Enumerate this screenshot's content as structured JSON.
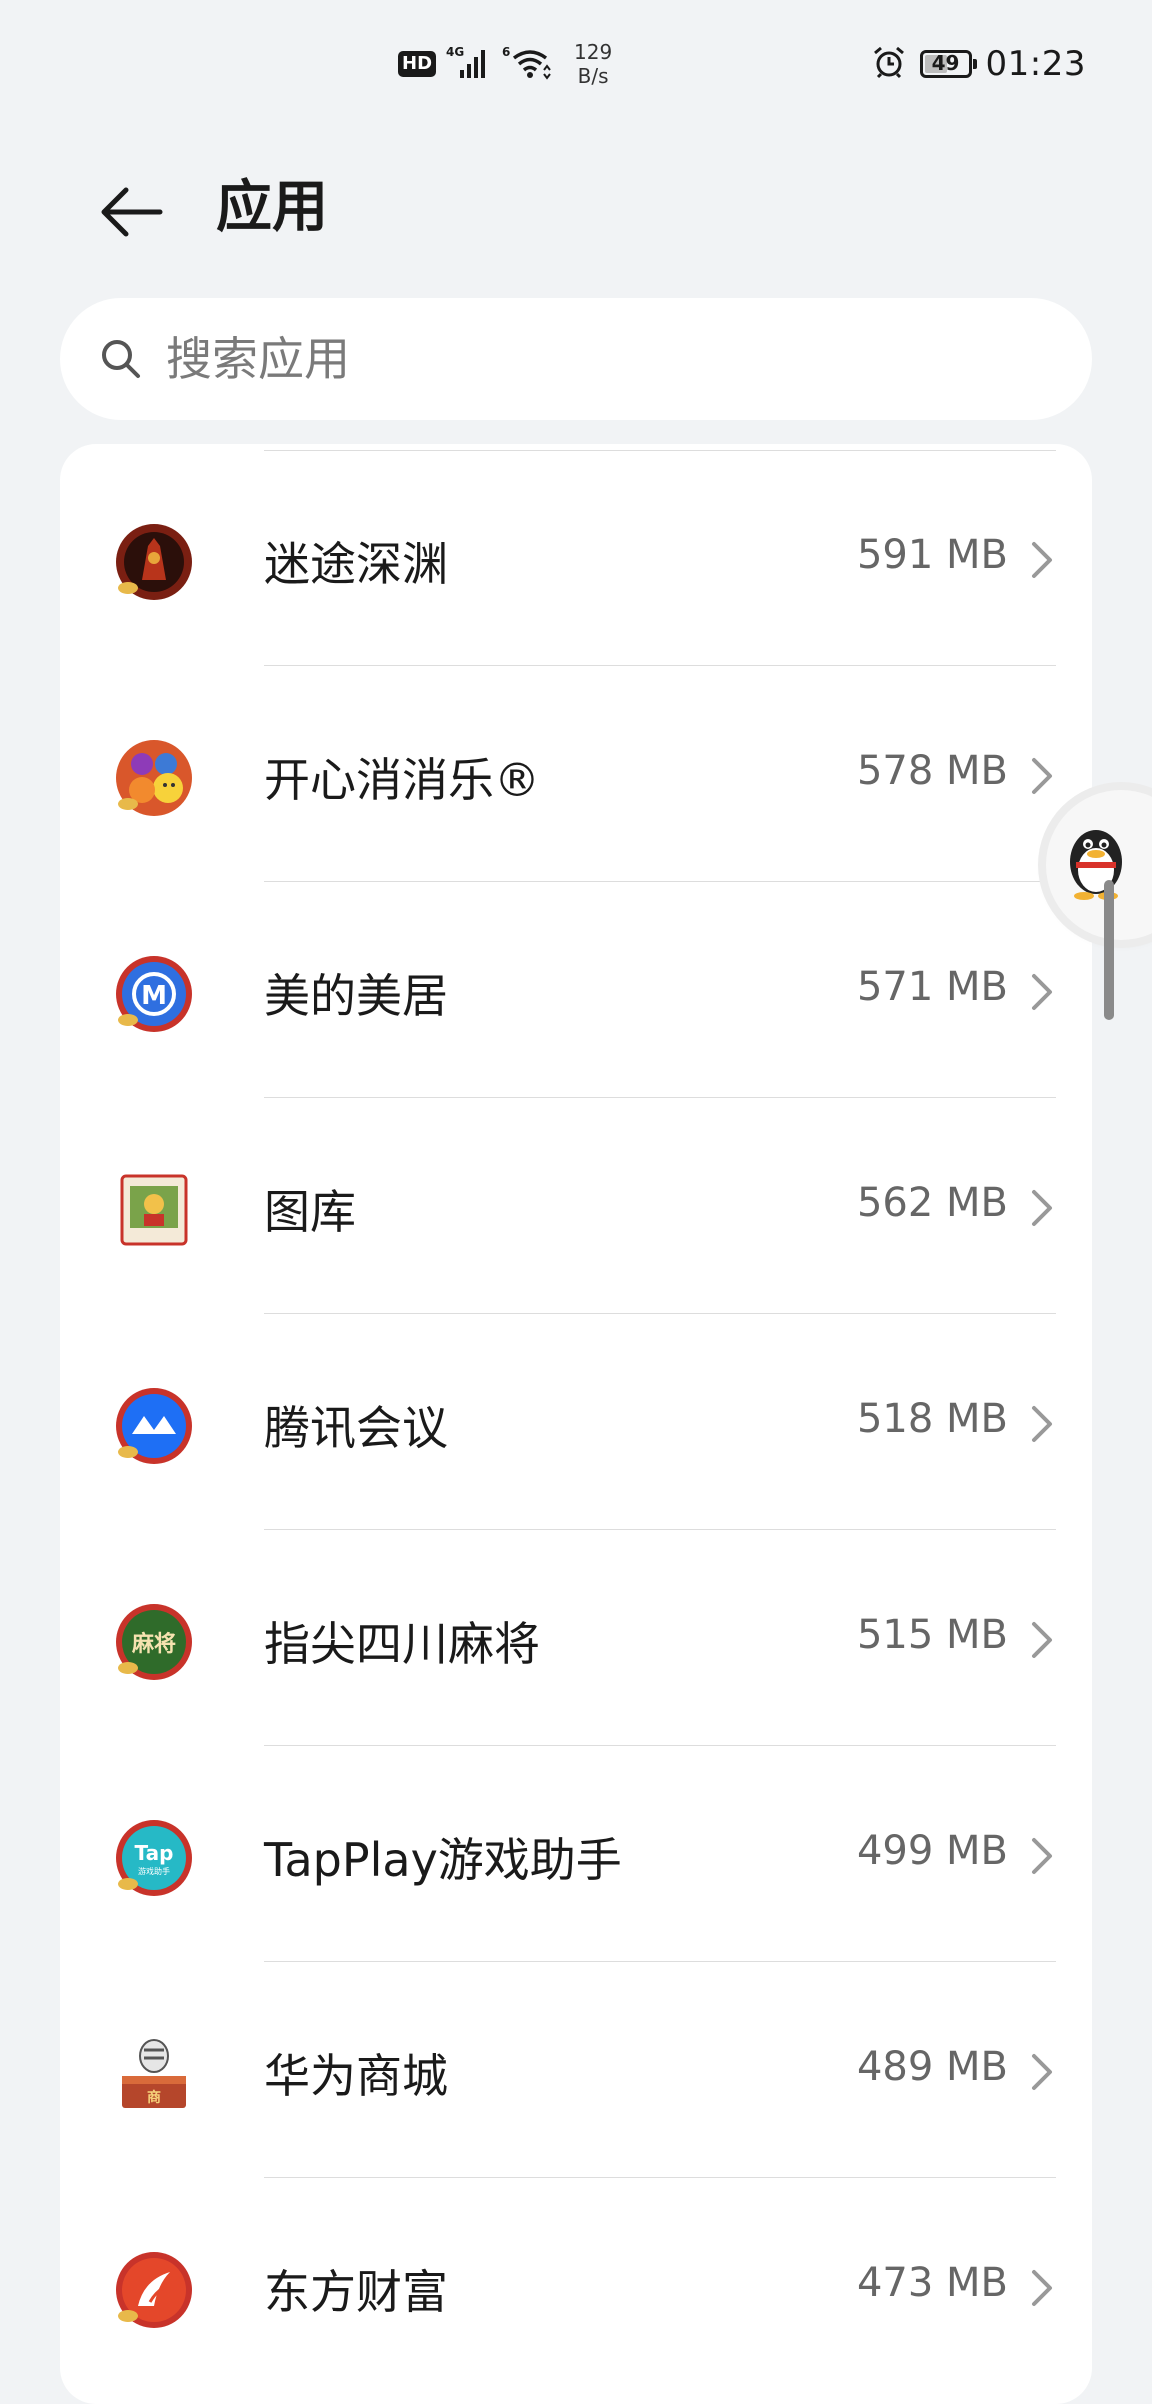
{
  "status_bar": {
    "hd_label": "HD",
    "network_label": "4G",
    "wifi_label": "6",
    "speed_value": "129",
    "speed_unit": "B/s",
    "battery_level": "49",
    "time": "01:23"
  },
  "header": {
    "title": "应用",
    "back_icon": "arrow-left-icon"
  },
  "search": {
    "placeholder": "搜索应用",
    "icon": "search-icon"
  },
  "apps": [
    {
      "name": "迷途深渊",
      "size": "591 MB",
      "icon_color": "#7a1f12"
    },
    {
      "name": "开心消消乐®",
      "size": "578 MB",
      "icon_color": "#d9572b"
    },
    {
      "name": "美的美居",
      "size": "571 MB",
      "icon_color": "#2f6fe0"
    },
    {
      "name": "图库",
      "size": "562 MB",
      "icon_color": "#c9a36a"
    },
    {
      "name": "腾讯会议",
      "size": "518 MB",
      "icon_color": "#1e6ff5"
    },
    {
      "name": "指尖四川麻将",
      "size": "515 MB",
      "icon_color": "#2f6b2a"
    },
    {
      "name": "TapPlay游戏助手",
      "size": "499 MB",
      "icon_color": "#26b9c6"
    },
    {
      "name": "华为商城",
      "size": "489 MB",
      "icon_color": "#b5462b"
    },
    {
      "name": "东方财富",
      "size": "473 MB",
      "icon_color": "#e4472a"
    }
  ],
  "icon_labels": {
    "majiang": "麻将",
    "tap": "Tap",
    "tap_sub": "游戏助手",
    "shop": "商"
  },
  "colors": {
    "background": "#f1f3f5",
    "card": "#ffffff",
    "secondary_text": "#666666",
    "divider": "#dddddd"
  }
}
